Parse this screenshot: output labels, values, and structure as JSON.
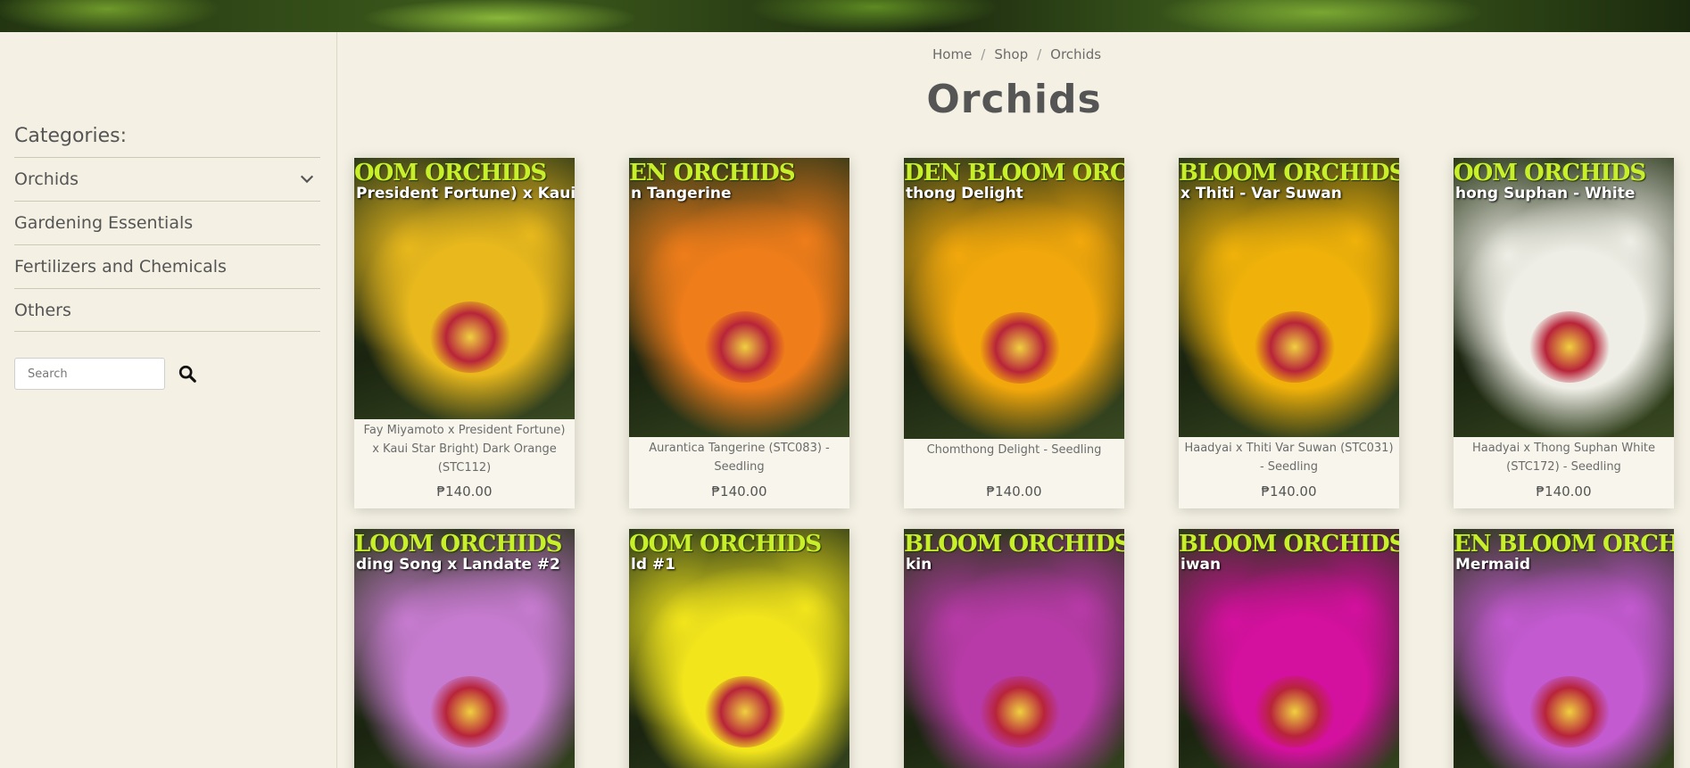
{
  "sidebar": {
    "title": "Categories:",
    "categories": [
      {
        "label": "Orchids",
        "expandable": true
      },
      {
        "label": "Gardening Essentials"
      },
      {
        "label": "Fertilizers and Chemicals"
      },
      {
        "label": "Others"
      }
    ],
    "search_placeholder": "Search"
  },
  "breadcrumb": [
    "Home",
    "Shop",
    "Orchids"
  ],
  "page_title": "Orchids",
  "currency": "₱",
  "products": [
    {
      "name": "Fay Miyamoto x President Fortune) x Kaui Star Bright) Dark Orange (STC112)",
      "price": "₱140.00",
      "overlay_brand": "OOM ORCHIDS",
      "overlay_text": "President Fortune) x Kaui Star B",
      "color": "#e8b81d"
    },
    {
      "name": "Aurantica Tangerine (STC083) - Seedling",
      "price": "₱140.00",
      "overlay_brand": "EN ORCHIDS",
      "overlay_text": "n Tangerine",
      "color": "#ef7d1a"
    },
    {
      "name": "Chomthong Delight - Seedling",
      "price": "₱140.00",
      "overlay_brand": "DEN BLOOM ORCHIDS",
      "overlay_text": "thong Delight",
      "color": "#f2a80c"
    },
    {
      "name": "Haadyai x Thiti Var Suwan (STC031) - Seedling",
      "price": "₱140.00",
      "overlay_brand": "BLOOM ORCHIDS",
      "overlay_text": "x Thiti - Var Suwan",
      "color": "#f0b20a"
    },
    {
      "name": "Haadyai x Thong Suphan White (STC172) - Seedling",
      "price": "₱140.00",
      "overlay_brand": "OOM ORCHIDS",
      "overlay_text": "hong Suphan - White",
      "color": "#efeee6"
    },
    {
      "name": "",
      "price": "",
      "overlay_brand": "LOOM ORCHIDS",
      "overlay_text": "ding Song x Landate #2",
      "color": "#c77bd0"
    },
    {
      "name": "",
      "price": "",
      "overlay_brand": "OOM ORCHIDS",
      "overlay_text": "ld #1",
      "color": "#f2e51c"
    },
    {
      "name": "",
      "price": "",
      "overlay_brand": "BLOOM ORCHIDS",
      "overlay_text": "kin",
      "color": "#b83aa8"
    },
    {
      "name": "",
      "price": "",
      "overlay_brand": "BLOOM ORCHIDS",
      "overlay_text": "iwan",
      "color": "#d4109e"
    },
    {
      "name": "",
      "price": "",
      "overlay_brand": "EN BLOOM ORCHIDS",
      "overlay_text": "Mermaid",
      "color": "#c35ad0"
    }
  ]
}
